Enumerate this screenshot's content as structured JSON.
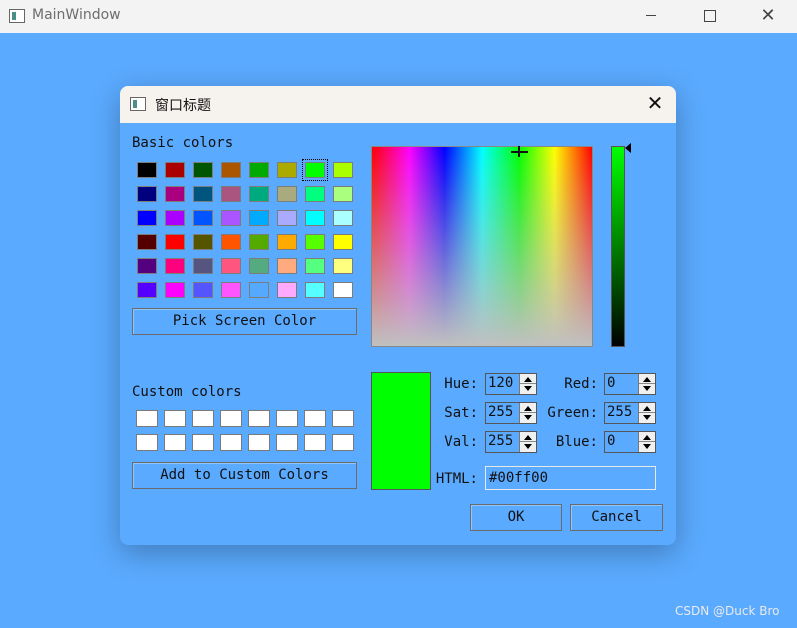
{
  "window": {
    "title": "MainWindow"
  },
  "dialog": {
    "title": "窗口标题"
  },
  "basic_colors": {
    "label": "Basic colors",
    "selected_index": 6,
    "rows": [
      [
        "#000000",
        "#aa0000",
        "#005500",
        "#aa5500",
        "#00aa00",
        "#aaaa00",
        "#00ff00",
        "#aaff00"
      ],
      [
        "#00007f",
        "#aa007f",
        "#00557f",
        "#aa557f",
        "#00aa7f",
        "#aaaa7f",
        "#00ff7f",
        "#aaff7f"
      ],
      [
        "#0000ff",
        "#aa00ff",
        "#0055ff",
        "#aa55ff",
        "#00aaff",
        "#aaaaff",
        "#00ffff",
        "#aaffff"
      ],
      [
        "#550000",
        "#ff0000",
        "#555500",
        "#ff5500",
        "#55aa00",
        "#ffaa00",
        "#55ff00",
        "#ffff00"
      ],
      [
        "#55007f",
        "#ff007f",
        "#55557f",
        "#ff557f",
        "#55aa7f",
        "#ffaa7f",
        "#55ff7f",
        "#ffff7f"
      ],
      [
        "#5500ff",
        "#ff00ff",
        "#5555ff",
        "#ff55ff",
        "#55aaff",
        "#ffaaff",
        "#55ffff",
        "#ffffff"
      ]
    ]
  },
  "pick_screen_color_label": "Pick Screen Color",
  "custom_colors": {
    "label": "Custom colors",
    "count": 16
  },
  "add_custom_label": "Add to Custom Colors",
  "current_color": "#00ff00",
  "fields": {
    "hue": {
      "label": "Hue:",
      "value": "120"
    },
    "sat": {
      "label": "Sat:",
      "value": "255"
    },
    "val": {
      "label": "Val:",
      "value": "255"
    },
    "red": {
      "label": "Red:",
      "value": "0"
    },
    "green": {
      "label": "Green:",
      "value": "255"
    },
    "blue": {
      "label": "Blue:",
      "value": "0"
    },
    "html": {
      "label": "HTML:",
      "value": "#00ff00"
    }
  },
  "buttons": {
    "ok": "OK",
    "cancel": "Cancel"
  },
  "watermark": "CSDN @Duck Bro"
}
